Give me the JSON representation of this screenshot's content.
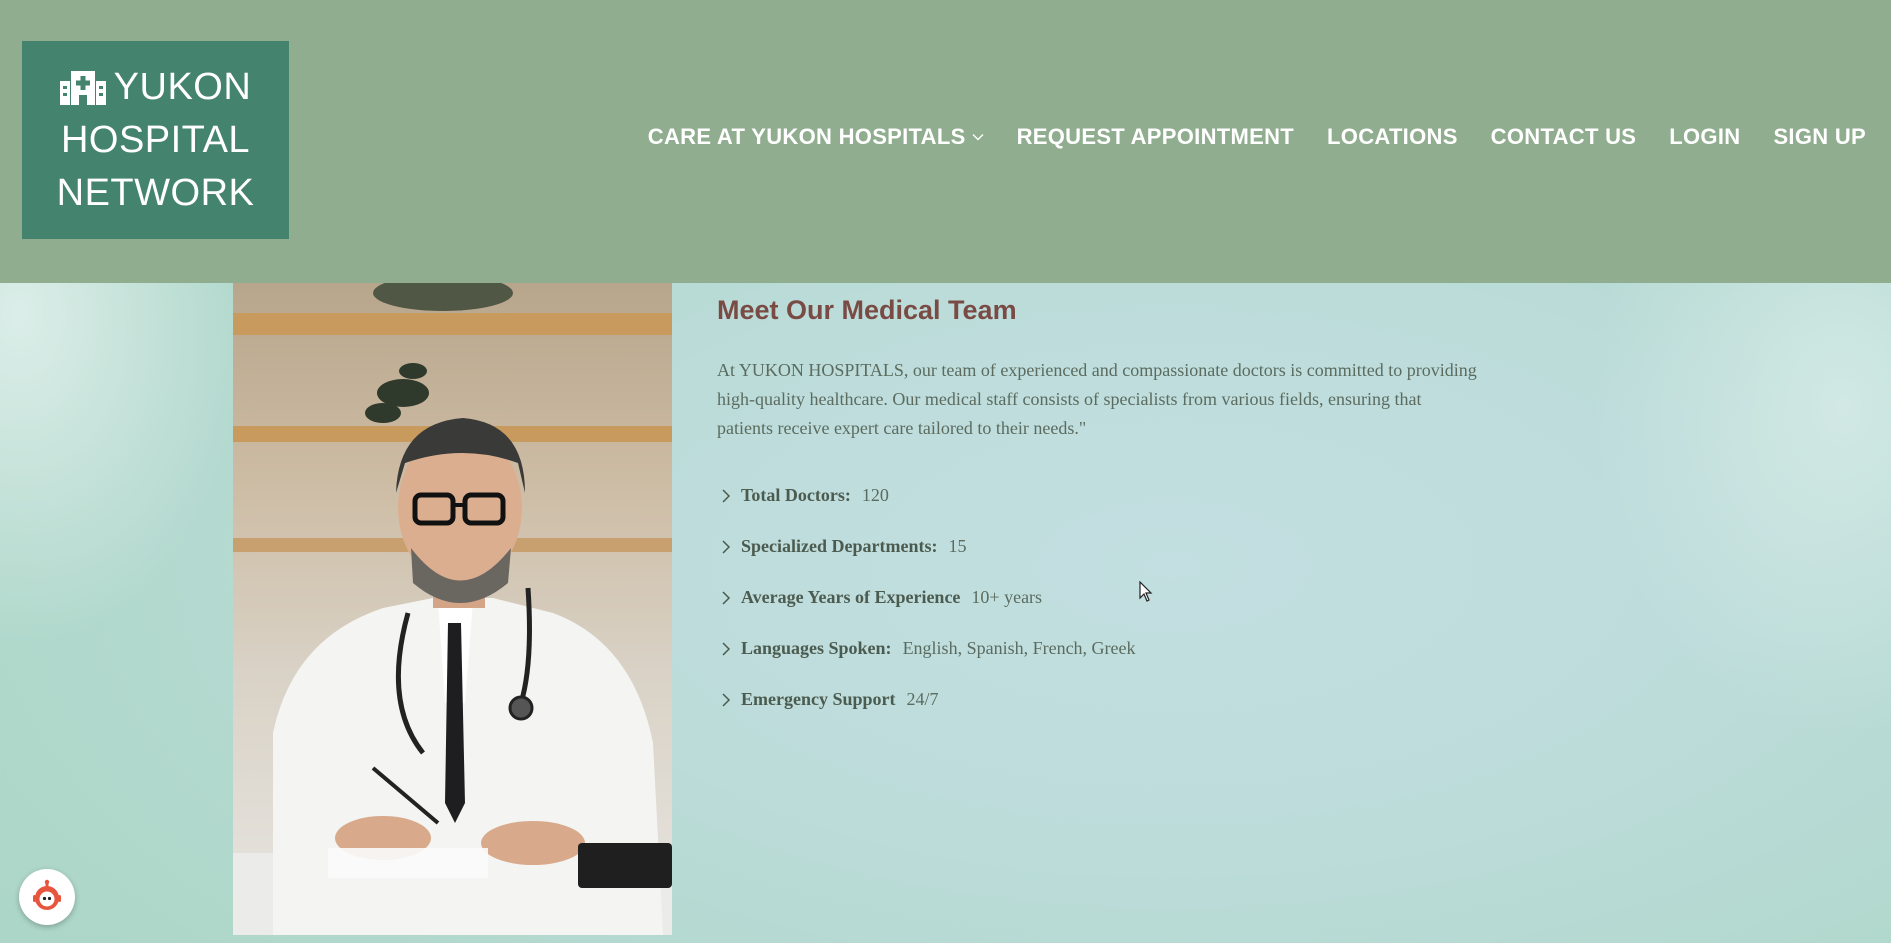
{
  "header": {
    "logo": {
      "line1": "YUKON",
      "line2": "HOSPITAL",
      "line3": "NETWORK",
      "icon": "hospital-icon"
    },
    "nav": {
      "care": "CARE AT YUKON HOSPITALS",
      "appointment": "REQUEST APPOINTMENT",
      "locations": "LOCATIONS",
      "contact": "CONTACT US",
      "login": "LOGIN",
      "signup": "SIGN UP"
    }
  },
  "main": {
    "title": "Meet Our Medical Team",
    "intro": "At YUKON HOSPITALS, our team of experienced and compassionate doctors is committed to providing high-quality healthcare. Our medical staff consists of specialists from various fields, ensuring that patients receive expert care tailored to their needs.\"",
    "stats": [
      {
        "label": "Total Doctors:",
        "value": "120"
      },
      {
        "label": "Specialized Departments:",
        "value": "15"
      },
      {
        "label": "Average Years of Experience",
        "value": "10+ years"
      },
      {
        "label": "Languages Spoken:",
        "value": "English, Spanish, French, Greek"
      },
      {
        "label": "Emergency Support",
        "value": "24/7"
      }
    ]
  },
  "colors": {
    "header_bg": "#90ae8f",
    "logo_bg": "#44836d",
    "title": "#7a4b44",
    "text": "#5b6b5f"
  },
  "icons": {
    "chat": "chatbot-icon",
    "cursor": "mouse-cursor-icon",
    "list_marker": "chevron-right-icon",
    "dropdown": "chevron-down-icon"
  }
}
